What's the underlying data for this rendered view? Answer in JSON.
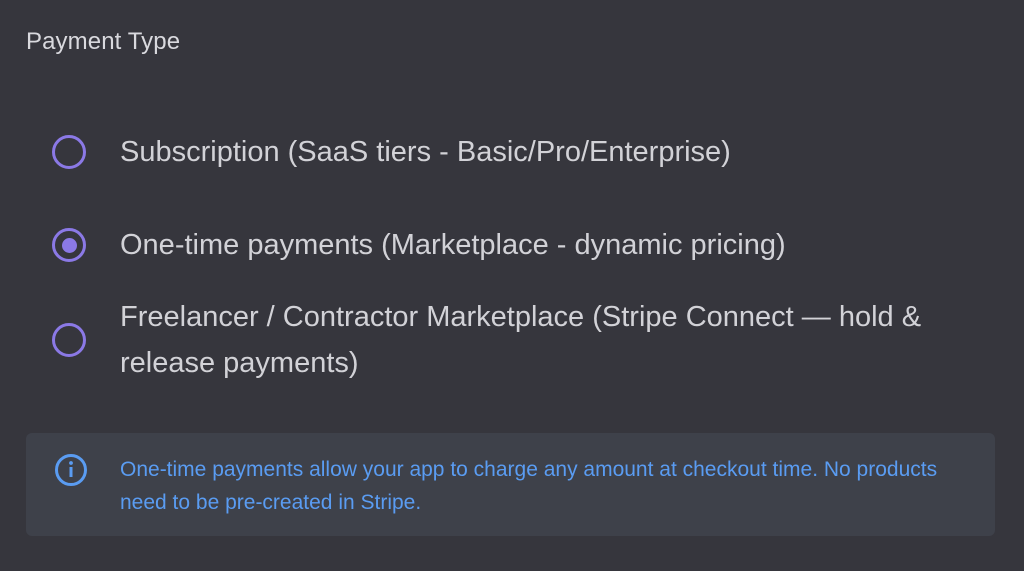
{
  "payment_type": {
    "title": "Payment Type",
    "options": [
      {
        "label": "Subscription (SaaS tiers - Basic/Pro/Enterprise)",
        "selected": false
      },
      {
        "label": "One-time payments (Marketplace - dynamic pricing)",
        "selected": true
      },
      {
        "label": "Freelancer / Contractor Marketplace (Stripe Connect — hold & release payments)",
        "selected": false
      }
    ]
  },
  "info": {
    "icon": "info-icon",
    "text": "One-time payments allow your app to charge any amount at checkout time. No products need to be pre-created in Stripe."
  },
  "colors": {
    "background": "#36363d",
    "radio_accent": "#8b79e6",
    "info_text": "#5a9cf2",
    "info_background": "#3e414a"
  }
}
